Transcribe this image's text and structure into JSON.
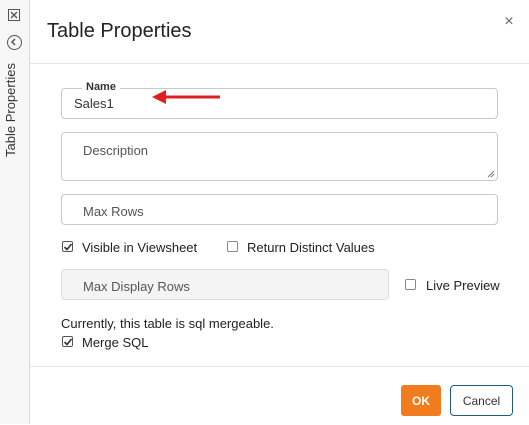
{
  "side_panel": {
    "label": "Table Properties",
    "close_icon": "close-box-icon",
    "back_icon": "circle-chevron-left-icon"
  },
  "dialog": {
    "title": "Table Properties",
    "close_glyph": "×"
  },
  "fields": {
    "name": {
      "legend": "Name",
      "value": "Sales1"
    },
    "description": {
      "placeholder": "Description",
      "value": ""
    },
    "max_rows": {
      "placeholder": "Max Rows",
      "value": ""
    },
    "max_display_rows": {
      "placeholder": "Max Display Rows",
      "value": ""
    }
  },
  "options": {
    "visible_in_viewsheet": {
      "label": "Visible in Viewsheet",
      "checked": true
    },
    "return_distinct": {
      "label": "Return Distinct Values",
      "checked": false
    },
    "live_preview": {
      "label": "Live Preview",
      "checked": false
    },
    "merge_sql": {
      "label": "Merge SQL",
      "checked": true
    }
  },
  "mergeable_note": "Currently, this table is sql mergeable.",
  "buttons": {
    "ok": "OK",
    "cancel": "Cancel"
  },
  "colors": {
    "accent": "#f07c1e",
    "arrow": "#e02020",
    "cancel_border": "#1f5e7a"
  }
}
